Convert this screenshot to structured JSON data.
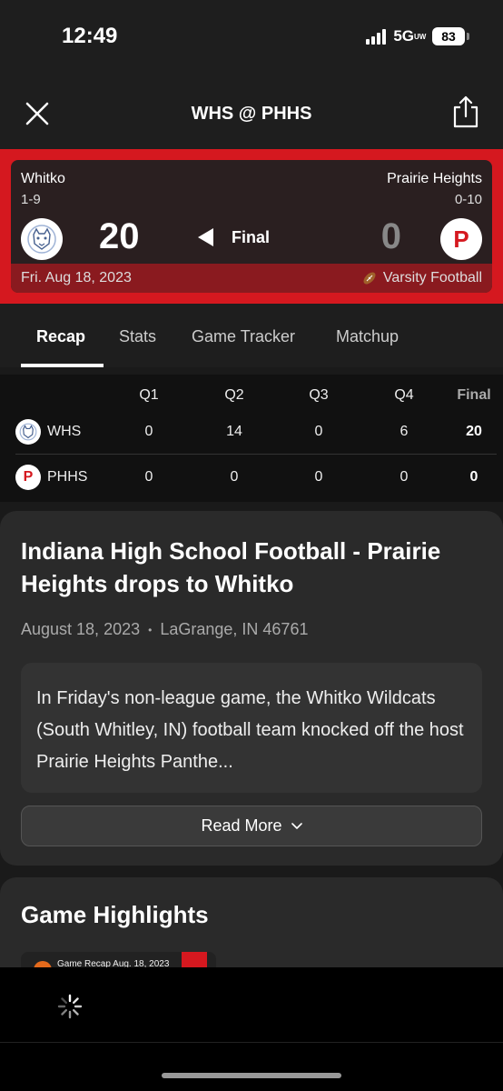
{
  "status_bar": {
    "time": "12:49",
    "network": "5G",
    "network_sub": "UW",
    "battery": "83"
  },
  "nav": {
    "title": "WHS @ PHHS",
    "close_icon": "close-icon",
    "share_icon": "share-icon"
  },
  "scoreboard": {
    "away": {
      "name": "Whitko",
      "record": "1-9",
      "score": "20",
      "abbr": "WHS"
    },
    "home": {
      "name": "Prairie Heights",
      "record": "0-10",
      "score": "0",
      "abbr": "PHHS",
      "logo_letter": "P"
    },
    "status": "Final",
    "date": "Fri. Aug 18, 2023",
    "level": "Varsity Football",
    "colors": {
      "accent": "#d5181f",
      "card_bg": "#2a1f20",
      "footer_bg": "#8a1a1f"
    }
  },
  "tabs": [
    "Recap",
    "Stats",
    "Game Tracker",
    "Matchup"
  ],
  "linescore": {
    "headers": [
      "Q1",
      "Q2",
      "Q3",
      "Q4",
      "Final"
    ],
    "rows": [
      {
        "team": "WHS",
        "scores": [
          "0",
          "14",
          "0",
          "6"
        ],
        "final": "20"
      },
      {
        "team": "PHHS",
        "scores": [
          "0",
          "0",
          "0",
          "0"
        ],
        "final": "0"
      }
    ]
  },
  "article": {
    "title": "Indiana High School Football - Prairie Heights drops to Whitko",
    "date": "August 18, 2023",
    "separator": "•",
    "location": "LaGrange, IN 46761",
    "excerpt": "In Friday's non-league game, the Whitko Wildcats (South Whitley, IN) football team knocked off the host Prairie Heights Panthe...",
    "read_more_label": "Read More"
  },
  "highlights": {
    "title": "Game Highlights",
    "thumb_label": "Game Recap   Aug. 18, 2023"
  }
}
